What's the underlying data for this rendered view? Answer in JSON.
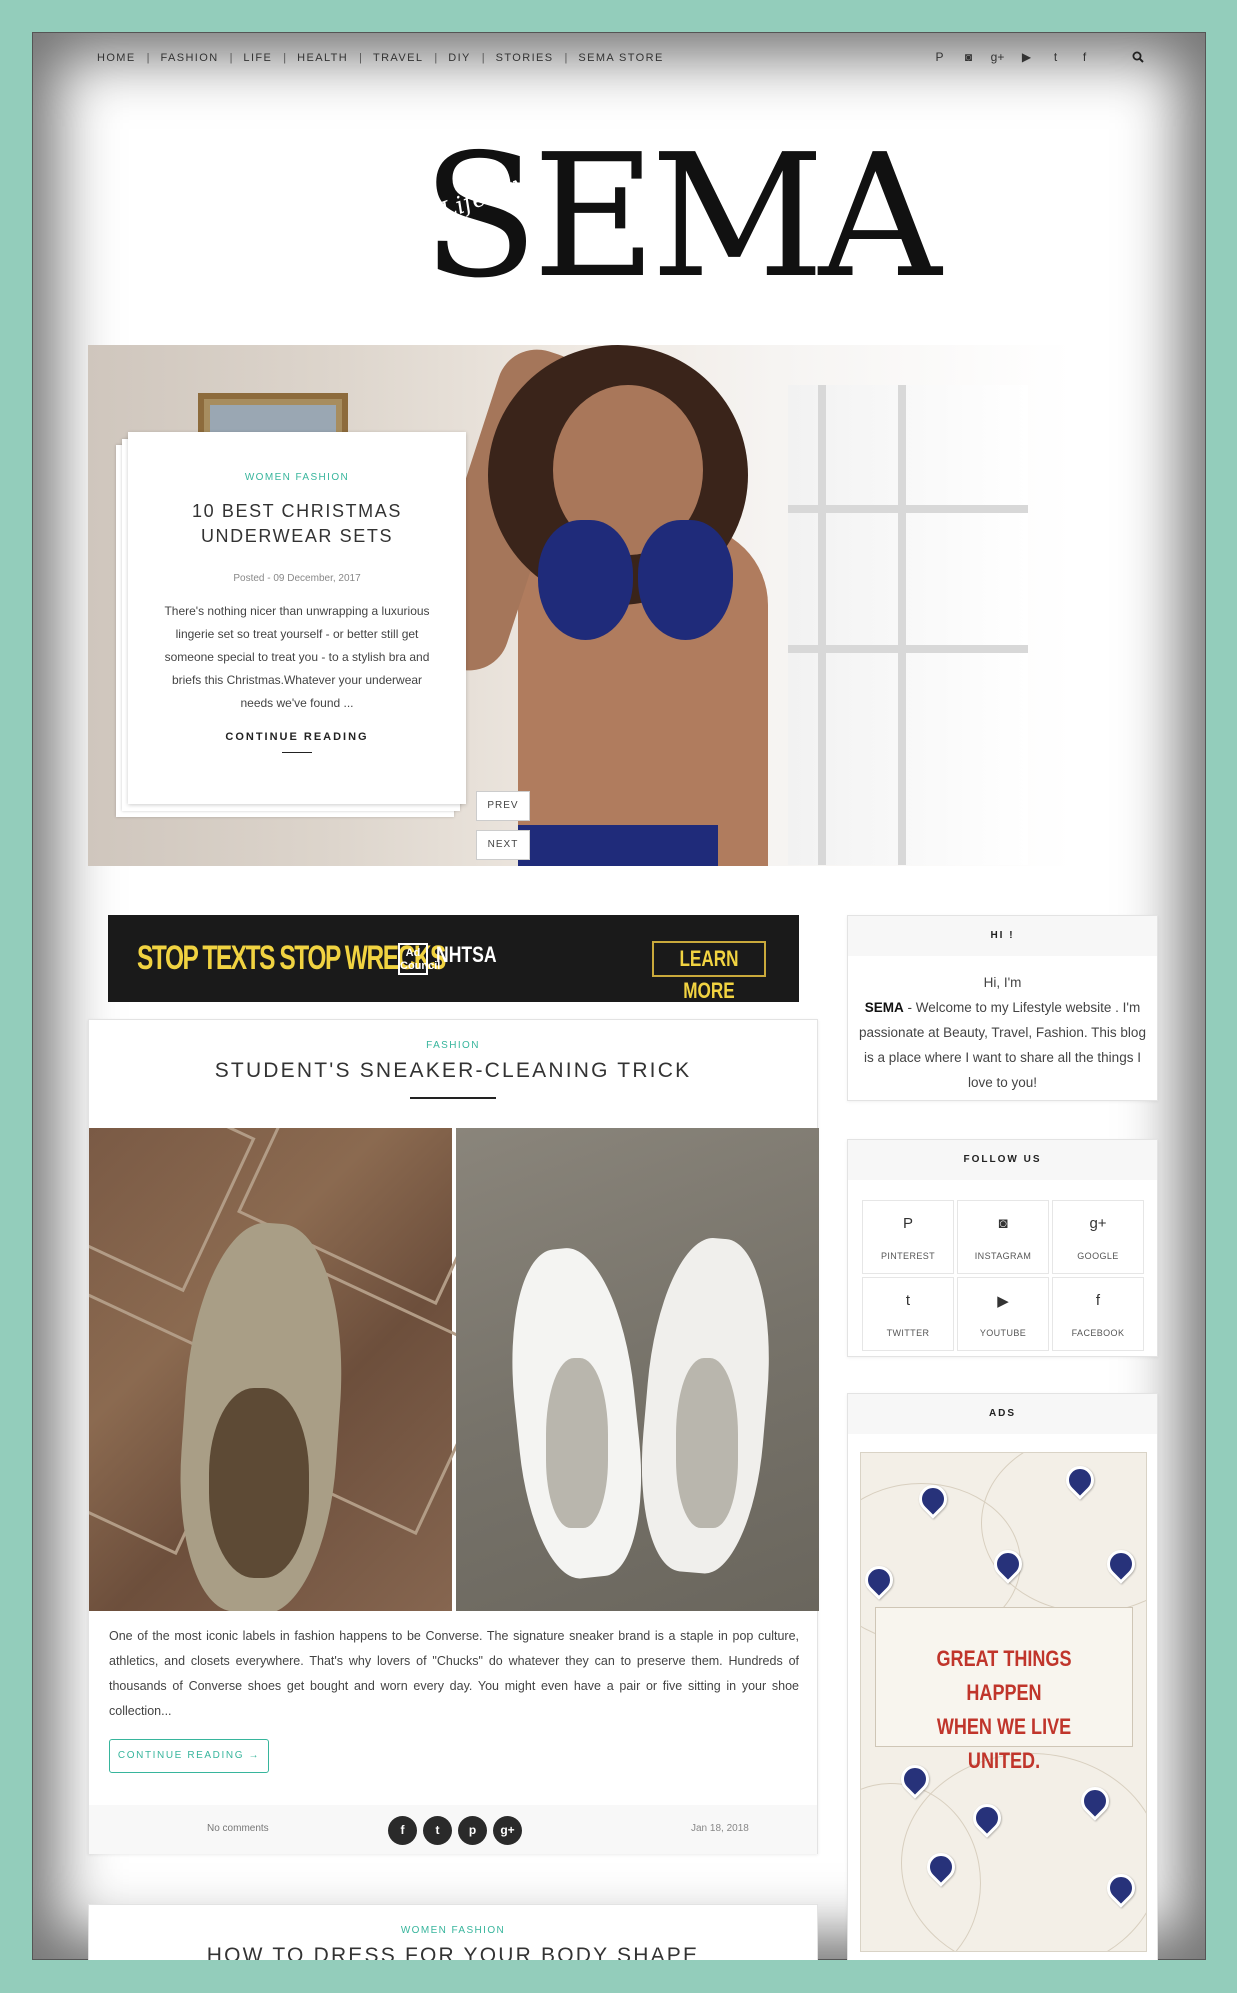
{
  "nav": {
    "items": [
      "HOME",
      "FASHION",
      "LIFE",
      "HEALTH",
      "TRAVEL",
      "DIY",
      "STORIES",
      "SEMA STORE"
    ]
  },
  "social_top": [
    "P",
    "◙",
    "g+",
    "▶",
    "t",
    "f"
  ],
  "logo": {
    "text": "SEMA",
    "script": "Life style"
  },
  "slider": {
    "category": "WOMEN FASHION",
    "title": "10 BEST CHRISTMAS UNDERWEAR SETS",
    "posted": "Posted - 09 December, 2017",
    "excerpt": "There's nothing nicer than unwrapping a luxurious lingerie set so treat yourself - or better still get someone special to treat you - to a stylish bra and briefs this Christmas.Whatever your underwear needs we've found ...",
    "continue": "CONTINUE READING",
    "prev": "PREV",
    "next": "NEXT"
  },
  "banner": {
    "headline": "STOP TEXTS STOP WRECKS",
    "adcouncil": "Ad Council",
    "org": "NHTSA",
    "cta": "LEARN MORE"
  },
  "post": {
    "category": "FASHION",
    "title": "STUDENT'S SNEAKER-CLEANING TRICK",
    "excerpt": "One of the most iconic labels in fashion happens to be Converse. The signature sneaker brand is a staple in pop culture, athletics, and closets everywhere. That's why lovers of \"Chucks\" do whatever they can to preserve them. Hundreds of thousands of Converse shoes get bought and worn every day. You might even have a pair or five sitting in your shoe collection...",
    "read_more": "CONTINUE READING →",
    "comments": "No comments",
    "share": [
      "f",
      "t",
      "p",
      "g+"
    ],
    "date": "Jan 18, 2018"
  },
  "post2": {
    "category": "WOMEN FASHION",
    "title": "HOW TO DRESS FOR YOUR BODY SHAPE"
  },
  "sidebar": {
    "hi": {
      "title": "HI !",
      "line1": "Hi, I'm",
      "name": "SEMA",
      "text": " - Welcome to my Lifestyle website . I'm passionate at Beauty, Travel, Fashion. This blog is a place where I want to share all the things I love to you!"
    },
    "follow": {
      "title": "FOLLOW US",
      "items": [
        {
          "label": "PINTEREST",
          "icon": "P"
        },
        {
          "label": "INSTAGRAM",
          "icon": "◙"
        },
        {
          "label": "GOOGLE",
          "icon": "g+"
        },
        {
          "label": "TWITTER",
          "icon": "t"
        },
        {
          "label": "YOUTUBE",
          "icon": "▶"
        },
        {
          "label": "FACEBOOK",
          "icon": "f"
        }
      ]
    },
    "ads": {
      "title": "ADS",
      "message_line1": "GREAT THINGS HAPPEN",
      "message_line2": "WHEN WE LIVE UNITED."
    }
  },
  "colors": {
    "accent": "#37b59c",
    "background": "#93cdbb",
    "ad_red": "#c0352b",
    "pin_blue": "#27327a"
  }
}
